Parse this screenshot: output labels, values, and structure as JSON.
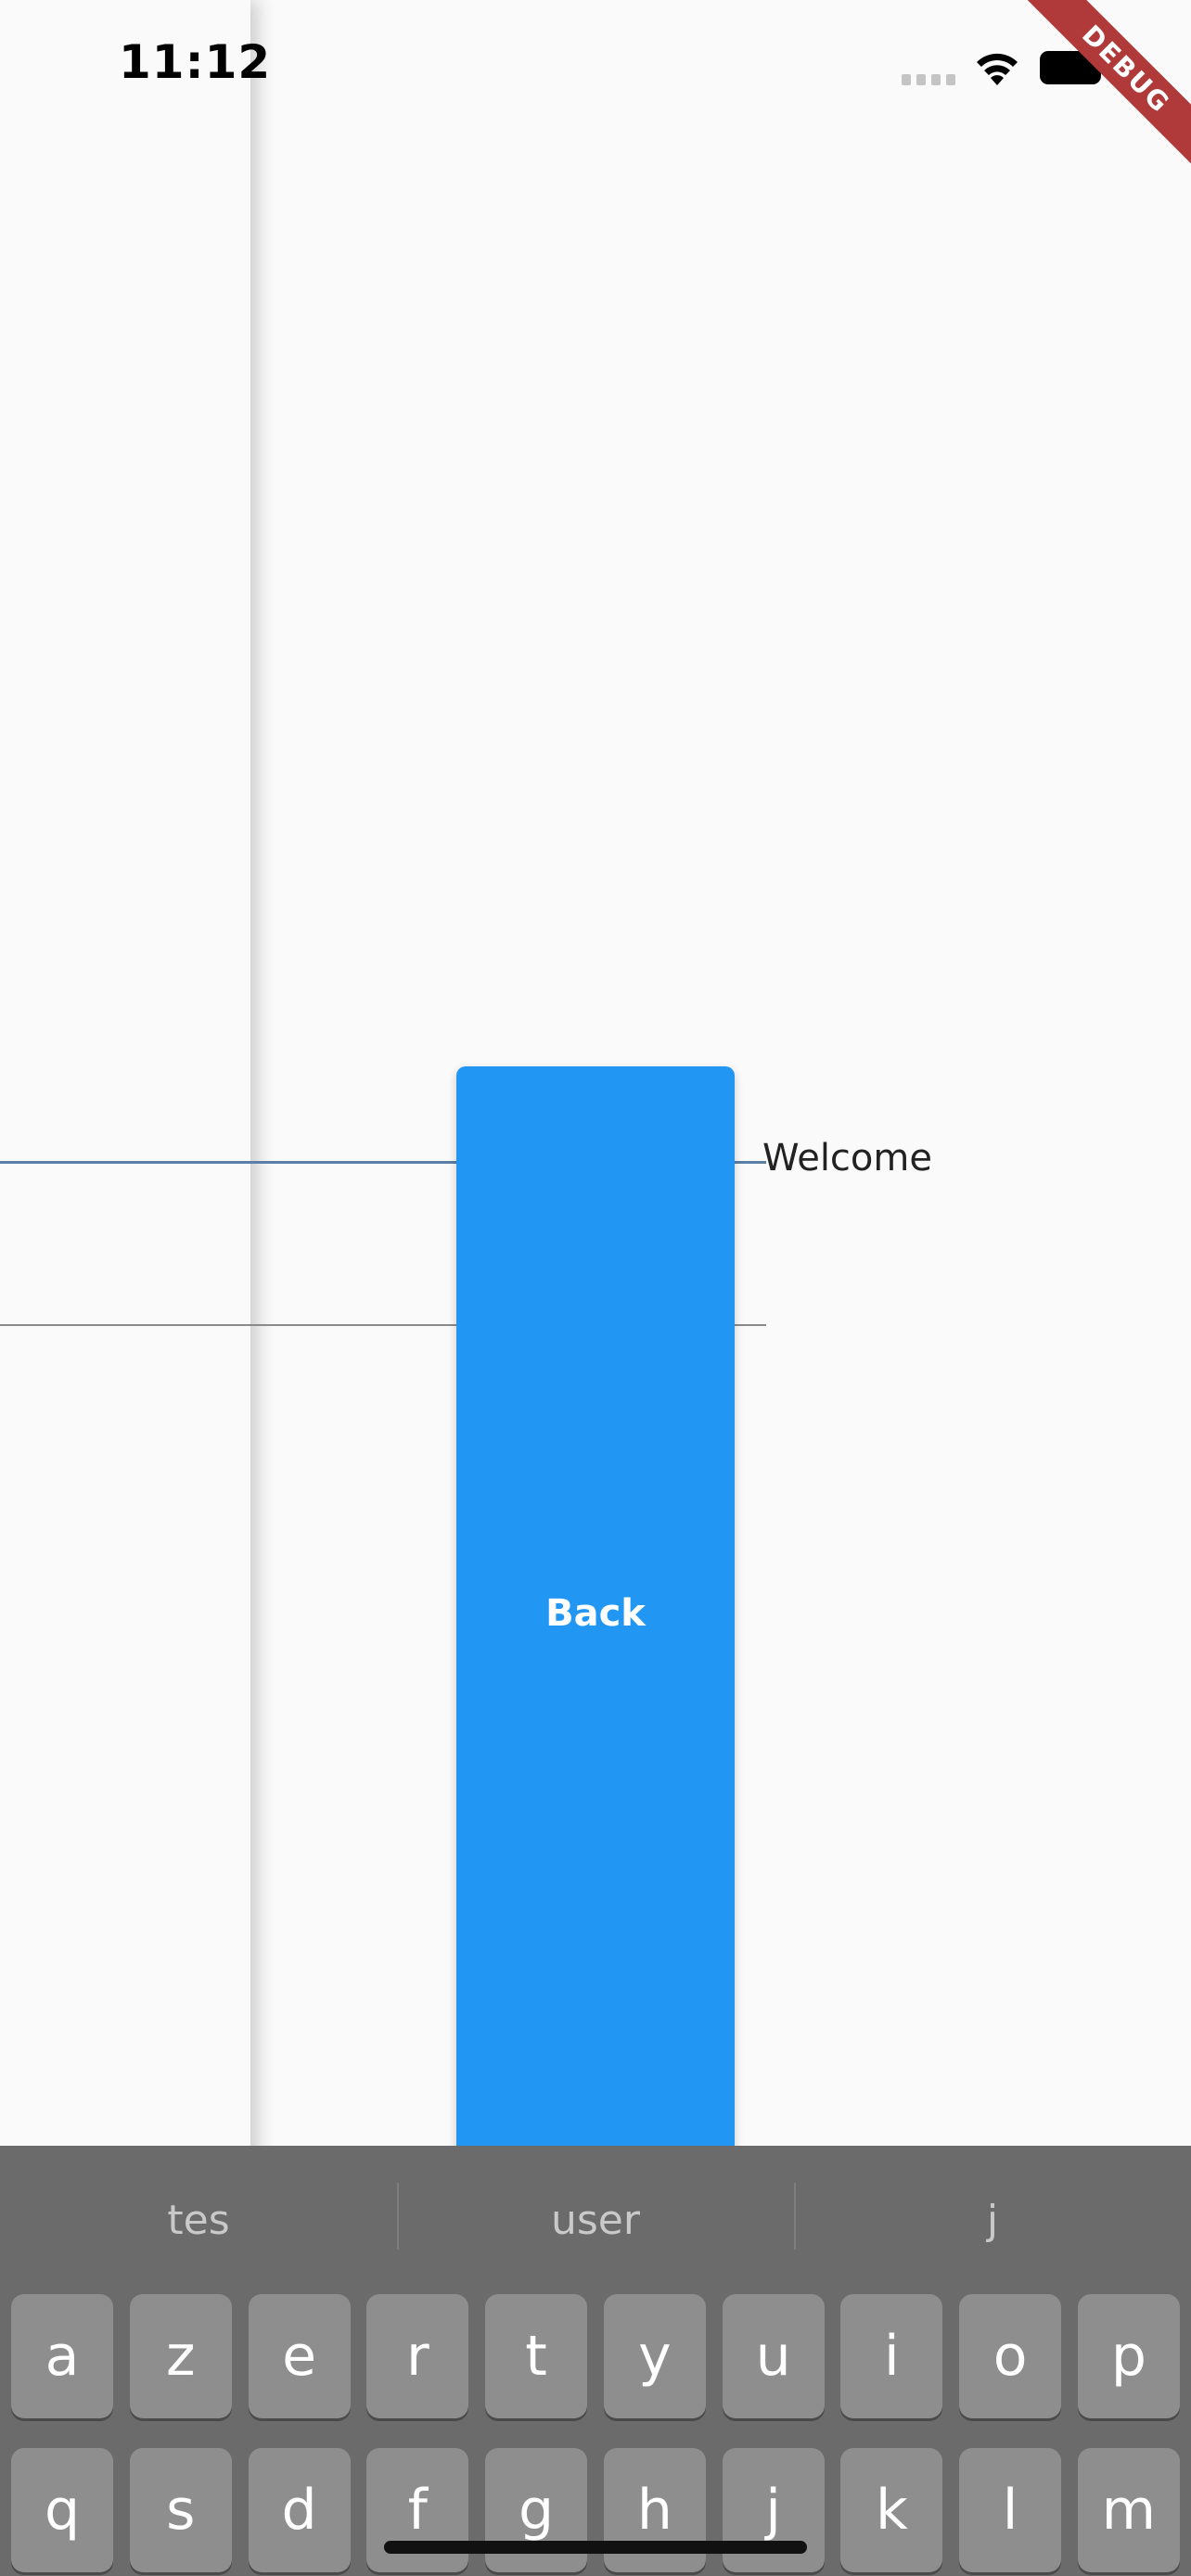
{
  "status_bar": {
    "time": "11:12"
  },
  "debug_banner": {
    "label": "DEBUG"
  },
  "form": {
    "welcome_label": "Welcome"
  },
  "back_button": {
    "label": "Back",
    "color": "#2196f3"
  },
  "keyboard": {
    "suggestions": [
      "tes",
      "user",
      "j"
    ],
    "rows": [
      [
        "a",
        "z",
        "e",
        "r",
        "t",
        "y",
        "u",
        "i",
        "o",
        "p"
      ],
      [
        "q",
        "s",
        "d",
        "f",
        "g",
        "h",
        "j",
        "k",
        "l",
        "m"
      ]
    ]
  }
}
